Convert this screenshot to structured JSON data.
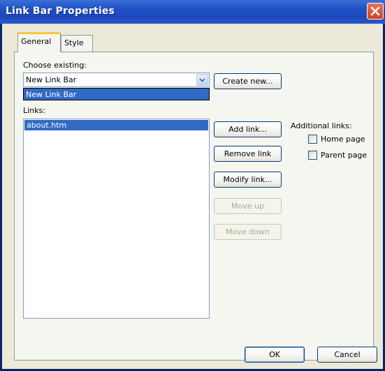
{
  "window": {
    "title": "Link Bar Properties"
  },
  "tabs": [
    {
      "label": "General",
      "active": true
    },
    {
      "label": "Style",
      "active": false
    }
  ],
  "general": {
    "choose_existing_label": "Choose existing:",
    "combo_value": "New Link Bar",
    "dropdown_options": [
      "New Link Bar"
    ],
    "create_new_label": "Create new...",
    "links_label": "Links:",
    "links": [
      "about.htm"
    ],
    "add_link_label": "Add link...",
    "remove_link_label": "Remove link",
    "modify_link_label": "Modify link...",
    "move_up_label": "Move up",
    "move_down_label": "Move down",
    "additional_links_label": "Additional links:",
    "home_page_label": "Home page",
    "home_page_checked": false,
    "parent_page_label": "Parent page",
    "parent_page_checked": false
  },
  "footer": {
    "ok_label": "OK",
    "cancel_label": "Cancel"
  },
  "colors": {
    "titlebar": "#1f4fc7",
    "selection": "#316ac5",
    "close_button": "#d3411e",
    "tab_highlight": "#ffc83c"
  }
}
